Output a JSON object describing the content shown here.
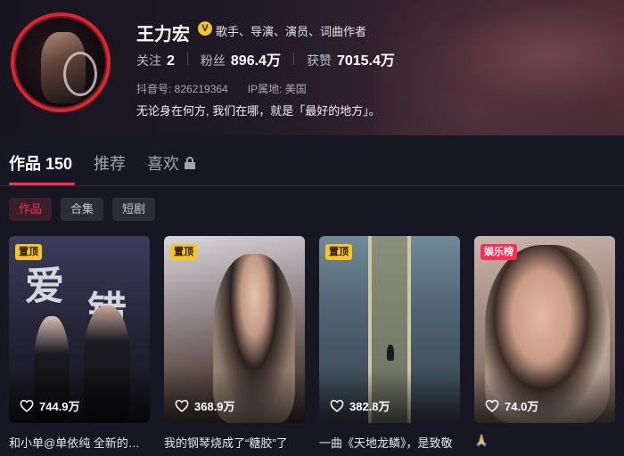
{
  "profile": {
    "name": "王力宏",
    "verified_badge": "V",
    "verified_text": "歌手、导演、演员、词曲作者",
    "stats": {
      "following_label": "关注",
      "following_value": "2",
      "followers_label": "粉丝",
      "followers_value": "896.4万",
      "likes_label": "获赞",
      "likes_value": "7015.4万"
    },
    "douyin_id": "抖音号: 826219364",
    "ip_location": "IP属地: 美国",
    "bio": "无论身在何方, 我们在哪，就是「最好的地方」。"
  },
  "tabs": {
    "works_label": "作品 150",
    "recommend_label": "推荐",
    "likes_label": "喜欢"
  },
  "filters": [
    "作品",
    "合集",
    "短剧"
  ],
  "videos": [
    {
      "badge": "置顶",
      "likes": "744.9万",
      "caption": "和小单@单依纯 全新的合唱 爱错",
      "poster_text_1": "爱",
      "poster_text_2": "错"
    },
    {
      "badge": "置顶",
      "likes": "368.9万",
      "caption": "我的钢琴烧成了“糖胶”了",
      "poster_text_1": "",
      "poster_text_2": ""
    },
    {
      "badge": "置顶",
      "likes": "382.8万",
      "caption": "一曲《天地龙鳞》，是致敬",
      "poster_text_1": "",
      "poster_text_2": ""
    },
    {
      "badge": "娱乐榜",
      "likes": "74.0万",
      "caption": "🙏🏼",
      "poster_text_1": "",
      "poster_text_2": ""
    }
  ],
  "colors": {
    "accent": "#fe2c55",
    "pin_badge": "#f8c51f",
    "background": "#161722"
  }
}
